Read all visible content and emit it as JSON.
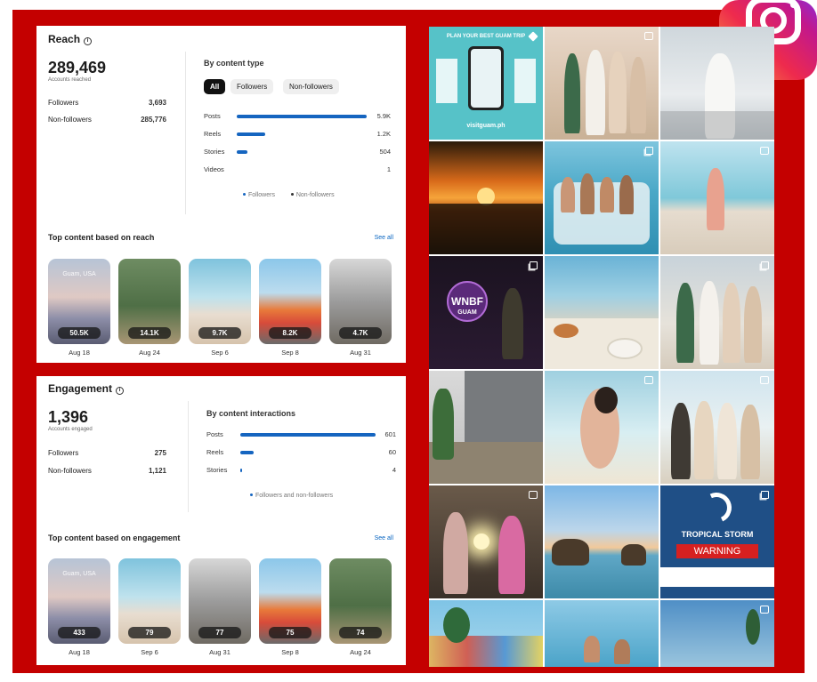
{
  "reach": {
    "title": "Reach",
    "total": "289,469",
    "total_caption": "Accounts reached",
    "followers_label": "Followers",
    "followers_value": "3,693",
    "nonfollowers_label": "Non-followers",
    "nonfollowers_value": "285,776",
    "by_type_heading": "By content type",
    "filters": [
      "All",
      "Followers",
      "Non-followers"
    ],
    "rows": [
      {
        "label": "Posts",
        "value": "5.9K",
        "fraction": 1.0
      },
      {
        "label": "Reels",
        "value": "1.2K",
        "fraction": 0.22
      },
      {
        "label": "Stories",
        "value": "504",
        "fraction": 0.08
      },
      {
        "label": "Videos",
        "value": "1",
        "fraction": 0.0
      }
    ],
    "legend_followers": "Followers",
    "legend_nonfollowers": "Non-followers",
    "top_heading": "Top content based on reach",
    "see_all": "See all",
    "top_items": [
      {
        "metric": "50.5K",
        "date": "Aug 18",
        "overlay": "Guam, USA"
      },
      {
        "metric": "14.1K",
        "date": "Aug 24",
        "overlay": ""
      },
      {
        "metric": "9.7K",
        "date": "Sep 6",
        "overlay": ""
      },
      {
        "metric": "8.2K",
        "date": "Sep 8",
        "overlay": ""
      },
      {
        "metric": "4.7K",
        "date": "Aug 31",
        "overlay": ""
      }
    ]
  },
  "engagement": {
    "title": "Engagement",
    "total": "1,396",
    "total_caption": "Accounts engaged",
    "followers_label": "Followers",
    "followers_value": "275",
    "nonfollowers_label": "Non-followers",
    "nonfollowers_value": "1,121",
    "by_interactions_heading": "By content interactions",
    "rows": [
      {
        "label": "Posts",
        "value": "601",
        "fraction": 1.0
      },
      {
        "label": "Reels",
        "value": "60",
        "fraction": 0.1
      },
      {
        "label": "Stories",
        "value": "4",
        "fraction": 0.01
      }
    ],
    "legend": "Followers and non-followers",
    "top_heading": "Top content based on engagement",
    "see_all": "See all",
    "top_items": [
      {
        "metric": "433",
        "date": "Aug 18",
        "overlay": "Guam, USA"
      },
      {
        "metric": "79",
        "date": "Sep 6",
        "overlay": ""
      },
      {
        "metric": "77",
        "date": "Aug 31",
        "overlay": ""
      },
      {
        "metric": "75",
        "date": "Sep 8",
        "overlay": ""
      },
      {
        "metric": "74",
        "date": "Aug 24",
        "overlay": ""
      }
    ]
  },
  "grid": {
    "tile1_heading": "PLAN YOUR BEST GUAM TRIP",
    "tile1_url": "visitguam.ph",
    "tile7_title": "WNBF",
    "tile7_sub": "GUAM",
    "tile15_title": "TROPICAL STORM",
    "tile15_warning": "WARNING"
  },
  "colors": {
    "frame_red": "#c40000",
    "bar_blue": "#1565c0",
    "link_blue": "#0a66c2"
  },
  "icons": [
    "info-icon",
    "reel-icon",
    "carousel-icon",
    "pin-icon",
    "instagram-logo"
  ]
}
